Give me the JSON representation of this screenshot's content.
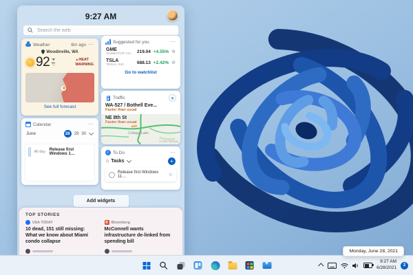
{
  "appearance": {
    "accent_blue": "#0b62c4",
    "link_blue": "#0b5cc2",
    "gain_green": "#179e57",
    "warning_red": "#8f2b1e",
    "start_blue": "#0c69d4"
  },
  "widgets_panel": {
    "time": "9:27 AM",
    "search_placeholder": "Search the web",
    "weather": {
      "title": "Weather",
      "updated": "6m ago",
      "location": "Woodinville, WA",
      "temperature": "92",
      "unit_primary": "°F",
      "unit_secondary": "°C",
      "alert_line1": "HEAT",
      "alert_line2": "WARNING",
      "link": "See full forecast"
    },
    "stocks": {
      "title": "Suggested for you",
      "rows": [
        {
          "symbol": "GME",
          "company": "GAMESTOP CO...",
          "price": "219.04",
          "change": "+4.55%"
        },
        {
          "symbol": "TSLA",
          "company": "TESLA, INC.",
          "price": "688.13",
          "change": "+2.42%"
        }
      ],
      "link": "Go to watchlist"
    },
    "traffic": {
      "title": "Traffic",
      "routes": [
        {
          "name": "WA-527 / Bothell Eve...",
          "status": "Faster than usual"
        },
        {
          "name": "NE 8th St",
          "status": "Faster than usual"
        }
      ],
      "map_label": "Cottage Lake",
      "attribution": "© 2021 TomTom"
    },
    "calendar": {
      "title": "Calendar",
      "month": "June",
      "selected_day": "28",
      "day2": "29",
      "day3": "30",
      "event_time": "All day",
      "event_title": "Release first Windows 1…"
    },
    "todo": {
      "title": "To Do",
      "list_label": "Tasks",
      "task_title": "Release first Windows 11…"
    },
    "add_widgets_label": "Add widgets",
    "top_stories": {
      "heading": "TOP STORIES",
      "stories": [
        {
          "source": "USA TODAY",
          "headline": "10 dead, 151 still missing: What we know about Miami condo collapse"
        },
        {
          "source": "Bloomberg",
          "headline": "McConnell wants infrastructure de-linked from spending bill"
        }
      ],
      "bloomberg_initial": "B"
    }
  },
  "taskbar": {
    "clock_time": "9:27 AM",
    "clock_date": "6/28/2021",
    "notification_count": "2"
  },
  "tooltip": {
    "date_text": "Monday, June 28, 2021"
  }
}
